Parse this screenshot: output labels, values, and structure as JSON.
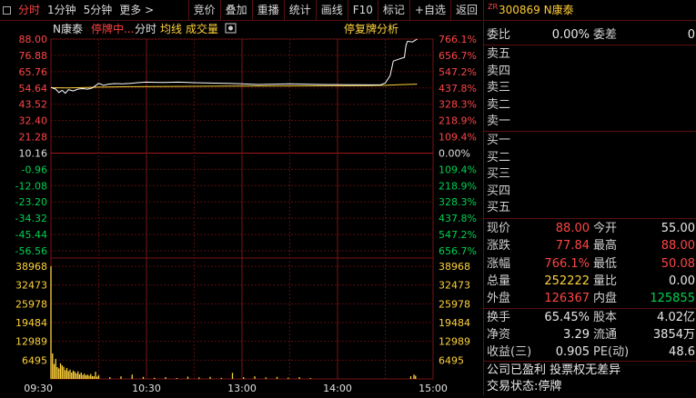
{
  "toolbar": {
    "tabs": [
      "分时",
      "1分钟",
      "5分钟"
    ],
    "more": "更多",
    "actions": [
      "竞价",
      "叠加",
      "重播",
      "统计",
      "画线",
      "F10",
      "标记",
      "+自选",
      "返回"
    ]
  },
  "legend": {
    "name": "N康泰",
    "status": "停牌中...",
    "type": "分时",
    "avg": "均线",
    "volume": "成交量",
    "analysis": "停复牌分析"
  },
  "chart_data": {
    "type": "line",
    "price_ticks": [
      "88.00",
      "76.88",
      "65.76",
      "54.64",
      "43.52",
      "32.40",
      "21.28",
      "10.16",
      "-0.96",
      "-12.08",
      "-23.20",
      "-34.32",
      "-45.44",
      "-56.56"
    ],
    "pct_ticks": [
      "766.1%",
      "656.7%",
      "547.2%",
      "437.8%",
      "328.3%",
      "218.9%",
      "109.4%",
      "0.00%",
      "109.4%",
      "218.9%",
      "328.3%",
      "437.8%",
      "547.2%",
      "656.7%"
    ],
    "vol_ticks": [
      "38968",
      "32473",
      "25978",
      "19484",
      "12989",
      "6495"
    ],
    "time_labels": [
      "09:30",
      "10:30",
      "13:00",
      "14:00",
      "15:00"
    ],
    "price_range": [
      -56.56,
      88.0
    ],
    "vol_max": 38968,
    "price_series": [
      [
        0,
        55.0
      ],
      [
        3,
        53.8
      ],
      [
        5,
        51.5
      ],
      [
        7,
        53.0
      ],
      [
        9,
        51.0
      ],
      [
        11,
        53.5
      ],
      [
        14,
        52.6
      ],
      [
        17,
        53.9
      ],
      [
        20,
        54.2
      ],
      [
        23,
        53.8
      ],
      [
        26,
        54.6
      ],
      [
        30,
        57.8
      ],
      [
        33,
        56.5
      ],
      [
        36,
        57.2
      ],
      [
        40,
        57.6
      ],
      [
        45,
        57.4
      ],
      [
        50,
        57.8
      ],
      [
        55,
        58.3
      ],
      [
        60,
        58.6
      ],
      [
        70,
        58.4
      ],
      [
        80,
        58.6
      ],
      [
        90,
        58.2
      ],
      [
        100,
        58.0
      ],
      [
        110,
        57.8
      ],
      [
        120,
        57.4
      ],
      [
        130,
        57.0
      ],
      [
        140,
        57.2
      ],
      [
        150,
        57.4
      ],
      [
        160,
        57.2
      ],
      [
        170,
        57.0
      ],
      [
        180,
        56.9
      ],
      [
        190,
        56.8
      ],
      [
        200,
        56.7
      ],
      [
        207,
        56.7
      ],
      [
        210,
        58.0
      ],
      [
        213,
        63.0
      ],
      [
        215,
        73.0
      ],
      [
        219,
        74.5
      ],
      [
        222,
        75.5
      ],
      [
        223,
        84.0
      ],
      [
        224,
        86.5
      ],
      [
        227,
        86.0
      ],
      [
        230,
        88.0
      ]
    ],
    "avg_series": [
      [
        0,
        54.8
      ],
      [
        10,
        54.7
      ],
      [
        20,
        54.9
      ],
      [
        30,
        55.2
      ],
      [
        50,
        55.5
      ],
      [
        80,
        55.7
      ],
      [
        110,
        55.9
      ],
      [
        140,
        56.0
      ],
      [
        170,
        56.1
      ],
      [
        200,
        56.2
      ],
      [
        210,
        56.4
      ],
      [
        220,
        56.9
      ],
      [
        230,
        57.2
      ]
    ],
    "volumes": [
      38968,
      8800,
      5200,
      6900,
      4100,
      3600,
      5400,
      4700,
      4200,
      3000,
      3800,
      2700,
      3200,
      2200,
      2900,
      2500,
      1900,
      2600,
      1600,
      2200,
      1400,
      1800,
      1200,
      1500,
      1100,
      1700,
      1000,
      900,
      2500,
      800,
      1300,
      600,
      900,
      1500,
      700,
      400,
      600,
      300,
      800,
      500,
      700,
      400,
      2100,
      600,
      900,
      500,
      700,
      400,
      600,
      300
    ]
  },
  "panel": {
    "prefix": "ZR",
    "code": "300869",
    "name": "N康泰",
    "webi_label": "委比",
    "webi_value": "0.00%",
    "weicha_label": "委差",
    "weicha_value": "0",
    "sell_labels": [
      "卖五",
      "卖四",
      "卖三",
      "卖二",
      "卖一"
    ],
    "buy_labels": [
      "买一",
      "买二",
      "买三",
      "买四",
      "买五"
    ],
    "quotes": [
      {
        "l1": "现价",
        "v1": "88.00",
        "c1": "red",
        "l2": "今开",
        "v2": "55.00",
        "c2": "white"
      },
      {
        "l1": "涨跌",
        "v1": "77.84",
        "c1": "red",
        "l2": "最高",
        "v2": "88.00",
        "c2": "red"
      },
      {
        "l1": "涨幅",
        "v1": "766.1%",
        "c1": "red",
        "l2": "最低",
        "v2": "50.08",
        "c2": "red"
      },
      {
        "l1": "总量",
        "v1": "252222",
        "c1": "yellow",
        "l2": "量比",
        "v2": "0.00",
        "c2": "white"
      },
      {
        "l1": "外盘",
        "v1": "126367",
        "c1": "red",
        "l2": "内盘",
        "v2": "125855",
        "c2": "green"
      }
    ],
    "fund": [
      {
        "l1": "换手",
        "v1": "65.45%",
        "l2": "股本",
        "v2": "4.02亿"
      },
      {
        "l1": "净资",
        "v1": "3.29",
        "l2": "流通",
        "v2": "3854万"
      },
      {
        "l1": "收益(三)",
        "v1": "0.905",
        "l2": "PE(动)",
        "v2": "48.6"
      }
    ],
    "note": "公司已盈利 投票权无差异",
    "trade_status": "交易状态:停牌"
  }
}
